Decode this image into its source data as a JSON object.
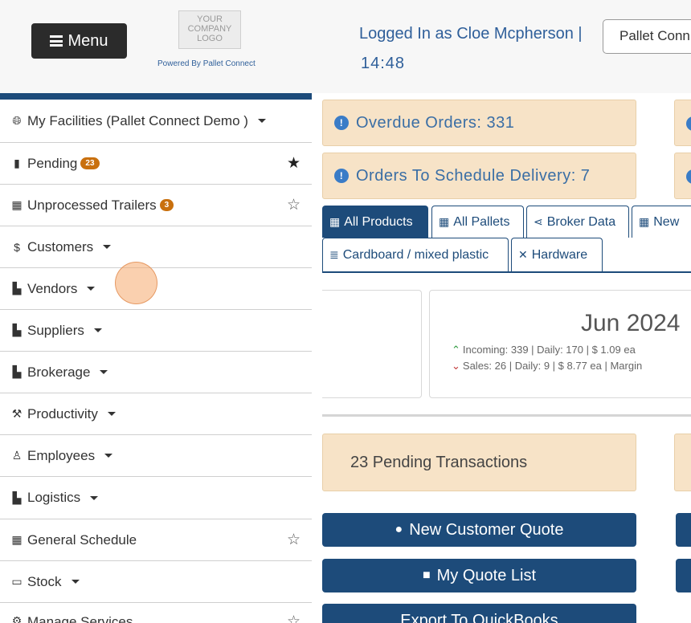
{
  "header": {
    "menu_label": "Menu",
    "logo_text": "YOUR COMPANY LOGO",
    "powered_by": "Powered By Pallet Connect",
    "logged_in": "Logged In as Cloe Mcpherson  |",
    "time": "14:48",
    "facility_select": "Pallet Conn"
  },
  "sidebar": {
    "items": [
      {
        "label": "My Facilities (Pallet Connect Demo )",
        "icon": "globe-icon"
      },
      {
        "label": "Pending",
        "icon": "clipboard-icon",
        "badge": "23"
      },
      {
        "label": "Unprocessed Trailers",
        "icon": "trailer-icon",
        "badge": "3"
      },
      {
        "label": "Customers",
        "icon": "dollar-icon"
      },
      {
        "label": "Vendors",
        "icon": "truck-icon"
      },
      {
        "label": "Suppliers",
        "icon": "truck-loading-icon"
      },
      {
        "label": "Brokerage",
        "icon": "truck-moving-icon"
      },
      {
        "label": "Productivity",
        "icon": "hammer-icon"
      },
      {
        "label": "Employees",
        "icon": "person-icon"
      },
      {
        "label": "Logistics",
        "icon": "truck-icon"
      },
      {
        "label": "General Schedule",
        "icon": "calendar-icon"
      },
      {
        "label": "Stock",
        "icon": "pallet-icon"
      },
      {
        "label": "Manage Services",
        "icon": "gear-icon"
      }
    ]
  },
  "alerts": {
    "overdue": "Overdue Orders: 331",
    "schedule": "Orders To Schedule Delivery: 7"
  },
  "tabs": [
    {
      "label": "All Products",
      "icon": "pallets-icon"
    },
    {
      "label": "All Pallets",
      "icon": "pallets-icon"
    },
    {
      "label": "Broker Data",
      "icon": "share-icon"
    },
    {
      "label": "New",
      "icon": "pallets-icon"
    },
    {
      "label": "Cardboard / mixed plastic",
      "icon": "list-icon"
    },
    {
      "label": "Hardware",
      "icon": "tools-icon"
    }
  ],
  "stats": {
    "month": "Jun 2024",
    "incoming": "Incoming: 339 | Daily: 170 | $ 1.09 ea",
    "sales": "Sales: 26 | Daily: 9 | $ 8.77 ea | Margin"
  },
  "pending_text": "23 Pending Transactions",
  "actions": {
    "new_quote": "New Customer Quote",
    "quote_list": "My Quote List",
    "export": "Export To QuickBooks"
  },
  "colors": {
    "brand_blue": "#1d4b7a",
    "alert_bg": "#f7e3c7",
    "badge": "#c9700e"
  }
}
